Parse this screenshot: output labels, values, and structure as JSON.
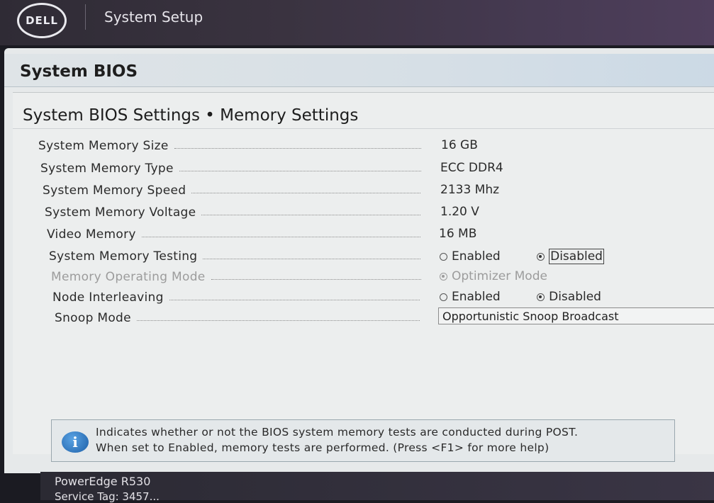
{
  "header": {
    "logo_text": "DELL",
    "app_title": "System Setup"
  },
  "panel": {
    "title": "System BIOS",
    "page_title": "System BIOS Settings • Memory Settings"
  },
  "settings": [
    {
      "label": "System Memory Size",
      "value": "16 GB"
    },
    {
      "label": "System Memory Type",
      "value": "ECC DDR4"
    },
    {
      "label": "System Memory Speed",
      "value": "2133 Mhz"
    },
    {
      "label": "System Memory Voltage",
      "value": "1.20 V"
    },
    {
      "label": "Video Memory",
      "value": "16 MB"
    },
    {
      "label": "System Memory Testing",
      "options": [
        "Enabled",
        "Disabled"
      ],
      "selected": "Disabled"
    },
    {
      "label": "Memory Operating Mode",
      "options": [
        "Optimizer Mode"
      ],
      "selected": "Optimizer Mode",
      "disabled": true
    },
    {
      "label": "Node Interleaving",
      "options": [
        "Enabled",
        "Disabled"
      ],
      "selected": "Disabled"
    },
    {
      "label": "Snoop Mode",
      "dropdown_value": "Opportunistic Snoop Broadcast"
    }
  ],
  "help": {
    "line1": "Indicates whether or not the BIOS system memory tests are conducted during POST.",
    "line2": "When set to Enabled, memory tests are performed. (Press <F1> for more help)"
  },
  "footer": {
    "model": "PowerEdge R530",
    "service_tag": "Service Tag: 3457..."
  }
}
